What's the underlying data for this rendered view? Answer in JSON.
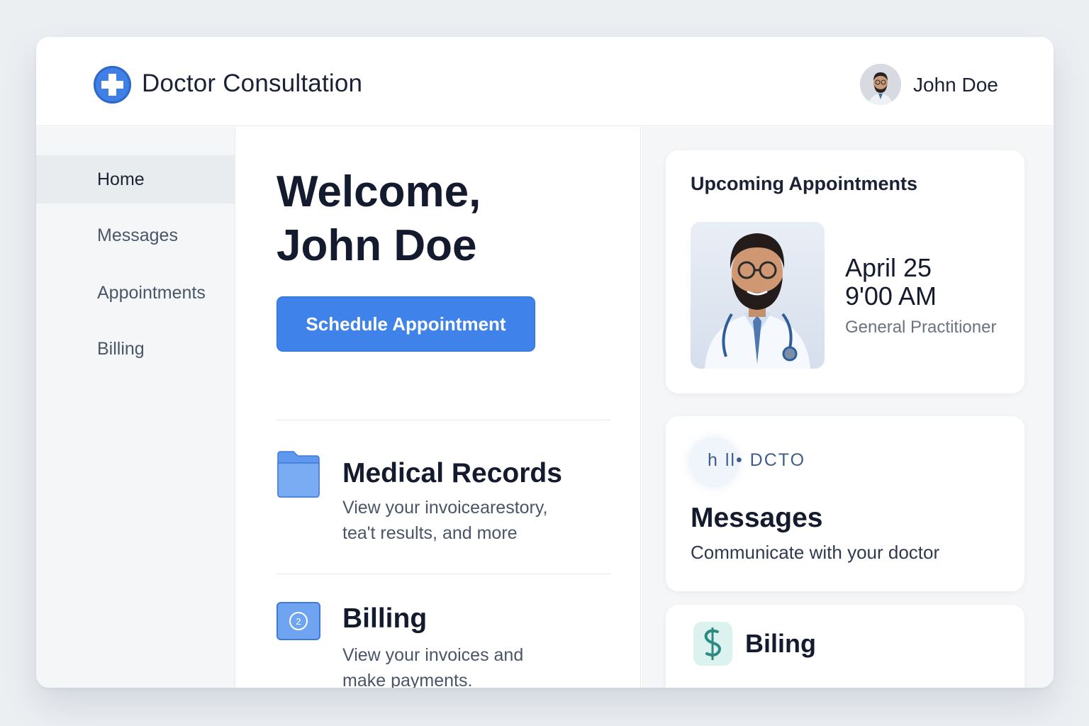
{
  "header": {
    "app_title": "Doctor Consultation",
    "user_name": "John Doe"
  },
  "sidebar": {
    "items": [
      {
        "label": "Home",
        "active": true
      },
      {
        "label": "Messages",
        "active": false
      },
      {
        "label": "Appointments",
        "active": false
      },
      {
        "label": "Billing",
        "active": false
      }
    ]
  },
  "main": {
    "welcome_line1": "Welcome,",
    "welcome_line2": "John Doe",
    "schedule_button": "Schedule Appointment",
    "features": [
      {
        "icon": "folder-icon",
        "title": "Medical Records",
        "desc_line1": "View your invoicearestory,",
        "desc_line2": "tea't results, and more"
      },
      {
        "icon": "billing-icon",
        "title": "Billing",
        "desc_line1": "View your invoices and",
        "desc_line2": "make payments."
      }
    ]
  },
  "right": {
    "appointments": {
      "heading": "Upcoming Appointments",
      "date": "April 25",
      "time": "9'00 AM",
      "role": "General Practitioner"
    },
    "messages": {
      "chip_text": "h ll• DCTO",
      "title": "Messages",
      "desc": "Communicate with your doctor"
    },
    "billing": {
      "title": "Biling"
    }
  },
  "colors": {
    "accent": "#3f82ea",
    "background": "#eceff2",
    "text_primary": "#141b2e",
    "text_secondary": "#4a5568"
  }
}
